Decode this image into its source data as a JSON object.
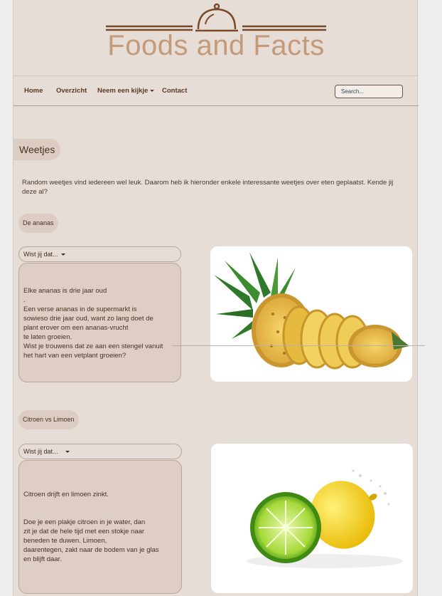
{
  "site": {
    "logo_text": "Foods and Facts"
  },
  "nav": {
    "items": [
      "Home",
      "Overzicht",
      "Neem een kijkje",
      "Contact"
    ],
    "search_placeholder": "Search..."
  },
  "main": {
    "title": "Weetjes",
    "intro": "Random weetjes vind iedereen wel leuk. Daarom heb ik hieronder enkele interessante weetjes over eten geplaatst. Kende jij deze al?"
  },
  "facts": [
    {
      "topic": "De ananas",
      "toggle": "Wist jij dat...",
      "headline": "Elke ananas is drie jaar oud",
      "dot": ".",
      "lines": [
        "Een verse ananas in de supermarkt is",
        "sowieso drie jaar oud, want zo lang doet de",
        "plant erover om een ananas-vrucht",
        "te laten groeien.",
        "Wist je trouwens dat ze aan een stengel vanuit",
        "het hart van een vetplant groeien?"
      ]
    },
    {
      "topic": "Citroen vs Limoen",
      "toggle": "Wist jij dat...",
      "headline": "Citroen drijft en limoen zinkt.",
      "lines": [
        "Doe je een plakje citroen in je water, dan",
        "zit je dat de hele tijd met een stokje naar",
        "beneden te duwen. Limoen,",
        "daarentegen, zakt naar de bodem van je glas",
        "en blijft daar."
      ]
    }
  ]
}
